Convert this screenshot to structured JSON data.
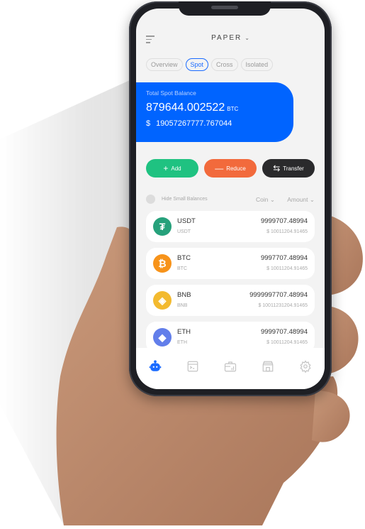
{
  "header": {
    "account": "PAPER",
    "account_chevron": "⌄"
  },
  "tabs": [
    {
      "label": "Overview",
      "active": false
    },
    {
      "label": "Spot",
      "active": true
    },
    {
      "label": "Cross",
      "active": false
    },
    {
      "label": "Isolated",
      "active": false
    }
  ],
  "balance": {
    "label": "Total Spot Balance",
    "btc_value": "879644.002522",
    "btc_unit": "BTC",
    "usd_symbol": "$",
    "usd_value": "19057267777.767044"
  },
  "actions": {
    "add_icon": "+",
    "add_label": "Add",
    "reduce_icon": "—",
    "reduce_label": "Reduce",
    "transfer_icon": "⇆",
    "transfer_label": "Transfer"
  },
  "filters": {
    "hide_small_label": "Hide Small Balances",
    "coin_sort": "Coin ⌄",
    "amount_sort": "Amount ⌄"
  },
  "assets": [
    {
      "symbol": "USDT",
      "sub": "USDT",
      "amount": "9999707.48994",
      "usd": "$ 10011204.91465",
      "glyph": "₮",
      "color": "#26a17b"
    },
    {
      "symbol": "BTC",
      "sub": "BTC",
      "amount": "9997707.48994",
      "usd": "$ 10011204.91465",
      "glyph": "₿",
      "color": "#f7931a"
    },
    {
      "symbol": "BNB",
      "sub": "BNB",
      "amount": "9999997707.48994",
      "usd": "$ 10011231204.91465",
      "glyph": "◈",
      "color": "#f3ba2f"
    },
    {
      "symbol": "ETH",
      "sub": "ETH",
      "amount": "9999707.48994",
      "usd": "$ 10011204.91465",
      "glyph": "◆",
      "color": "#627eea"
    }
  ],
  "nav": {
    "items": [
      "bot",
      "terminal",
      "portfolio",
      "marketplace",
      "settings"
    ],
    "active_color": "#1a6bff",
    "inactive_color": "#c4c4c4"
  }
}
